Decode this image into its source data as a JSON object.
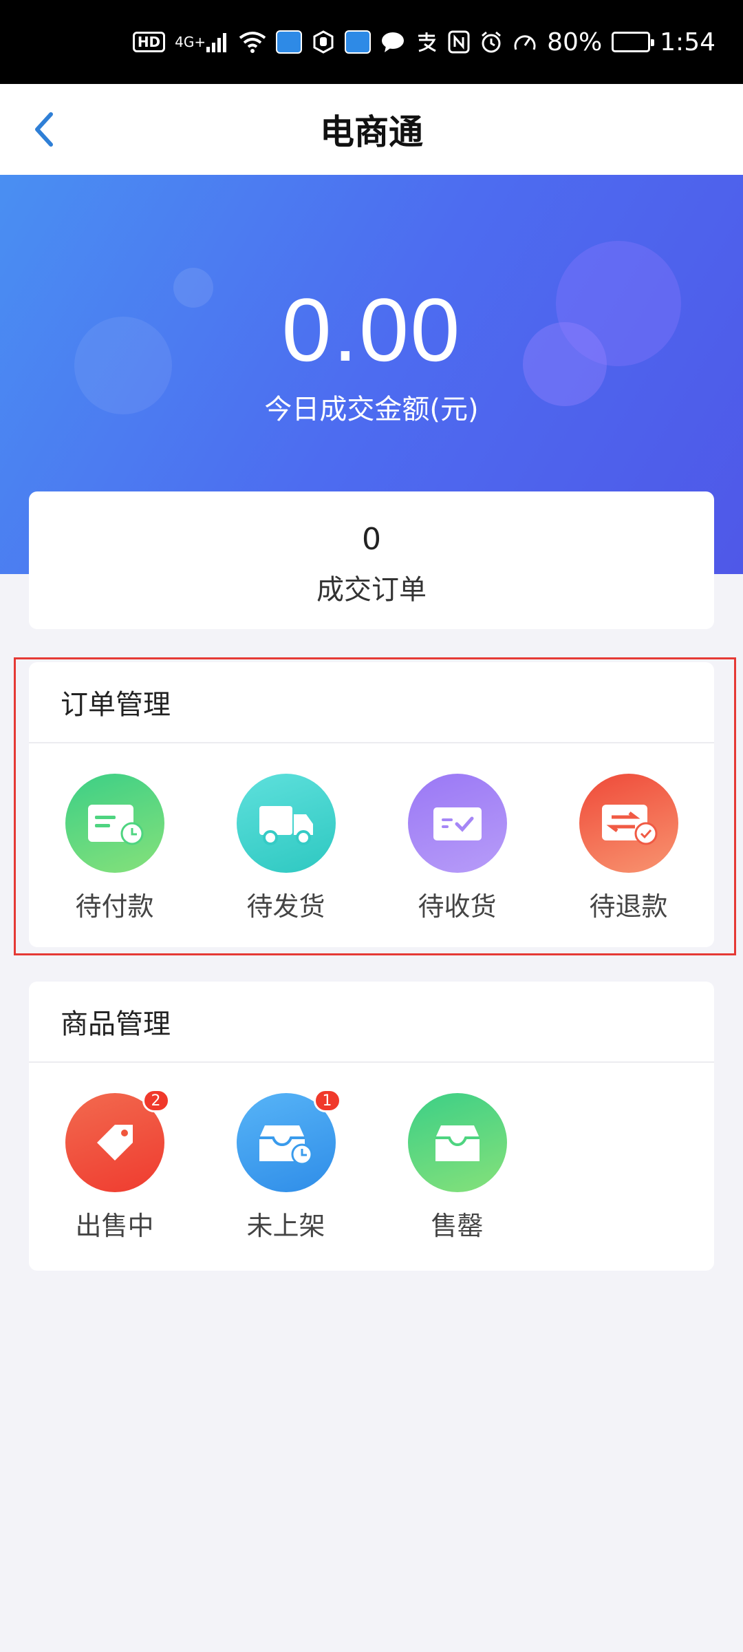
{
  "status_bar": {
    "hd": "HD",
    "network": "4G+",
    "battery_percent": "80%",
    "battery_level": 0.8,
    "time": "1:54"
  },
  "header": {
    "title": "电商通",
    "back_icon": "chevron-left-icon"
  },
  "hero": {
    "amount": "0.00",
    "label": "今日成交金额(元)"
  },
  "stats": {
    "orders_value": "0",
    "orders_label": "成交订单"
  },
  "order_management": {
    "title": "订单管理",
    "items": [
      {
        "label": "待付款",
        "icon": "pending-payment-icon"
      },
      {
        "label": "待发货",
        "icon": "truck-icon"
      },
      {
        "label": "待收货",
        "icon": "receive-check-icon"
      },
      {
        "label": "待退款",
        "icon": "refund-icon"
      }
    ]
  },
  "goods_management": {
    "title": "商品管理",
    "items": [
      {
        "label": "出售中",
        "icon": "price-tag-icon",
        "badge": "2"
      },
      {
        "label": "未上架",
        "icon": "inbox-clock-icon",
        "badge": "1"
      },
      {
        "label": "售罄",
        "icon": "inbox-icon"
      }
    ]
  },
  "colors": {
    "accent": "#2f7fd6",
    "hero_start": "#4a8ff2",
    "hero_end": "#4f58e8",
    "badge": "#f0392b",
    "highlight": "#e53935"
  }
}
